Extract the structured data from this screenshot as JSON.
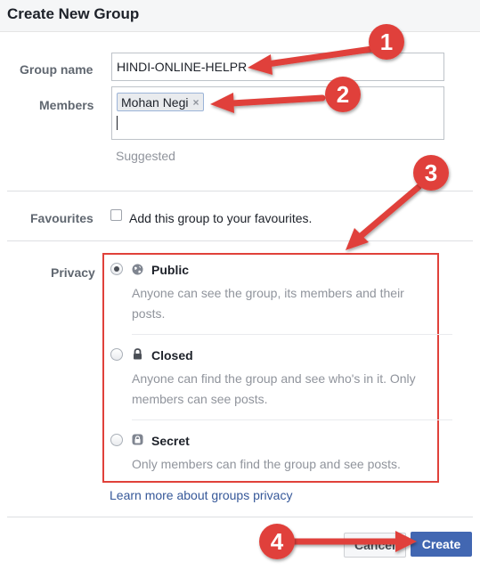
{
  "dialog": {
    "title": "Create New Group"
  },
  "form": {
    "group_name_label": "Group name",
    "group_name_value": "HINDI-ONLINE-HELPR",
    "members_label": "Members",
    "member_token": "Mohan Negi",
    "token_remove": "×",
    "suggested": "Suggested",
    "favourites_label": "Favourites",
    "favourites_text": "Add this group to your favourites.",
    "favourites_checked": false,
    "privacy_label": "Privacy",
    "privacy_options": [
      {
        "title": "Public",
        "desc_line1": "Anyone can see the group, its members and their",
        "desc_line2": "posts.",
        "checked": true,
        "icon": "globe-icon"
      },
      {
        "title": "Closed",
        "desc_line1": "Anyone can find the group and see who's in it. Only",
        "desc_line2": "members can see posts.",
        "checked": false,
        "icon": "lock-icon"
      },
      {
        "title": "Secret",
        "desc_line1": "Only members can find the group and see posts.",
        "desc_line2": "",
        "checked": false,
        "icon": "secret-lock-icon"
      }
    ],
    "learn_more": "Learn more about groups privacy"
  },
  "footer": {
    "cancel_label": "Cancel",
    "create_label": "Create"
  },
  "annotations": {
    "badges": [
      "1",
      "2",
      "3",
      "4"
    ],
    "color": "#e0413a"
  },
  "colors": {
    "accent": "#4267b2",
    "link": "#365899",
    "annotation": "#e0413a"
  }
}
